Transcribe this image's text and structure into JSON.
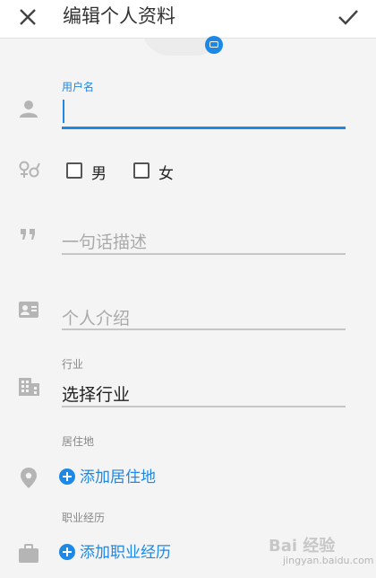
{
  "header": {
    "title": "编辑个人资料",
    "close_icon": "close-icon",
    "confirm_icon": "check-icon"
  },
  "username": {
    "label": "用户名",
    "value": ""
  },
  "gender": {
    "options": [
      "男",
      "女"
    ],
    "selected": null
  },
  "bio_short": {
    "placeholder": "一句话描述"
  },
  "intro": {
    "placeholder": "个人介绍"
  },
  "industry": {
    "label": "行业",
    "value": "选择行业"
  },
  "residence": {
    "label": "居住地",
    "add_label": "添加居住地"
  },
  "career": {
    "label": "职业经历",
    "add_label": "添加职业经历"
  },
  "watermark": {
    "main": "Bai 经验",
    "sub": "jingyan.baidu.com"
  },
  "colors": {
    "accent": "#1e88e5",
    "background": "#f4f4f4",
    "header_bg": "#ffffff",
    "icon_gray": "#b5b5b5"
  }
}
